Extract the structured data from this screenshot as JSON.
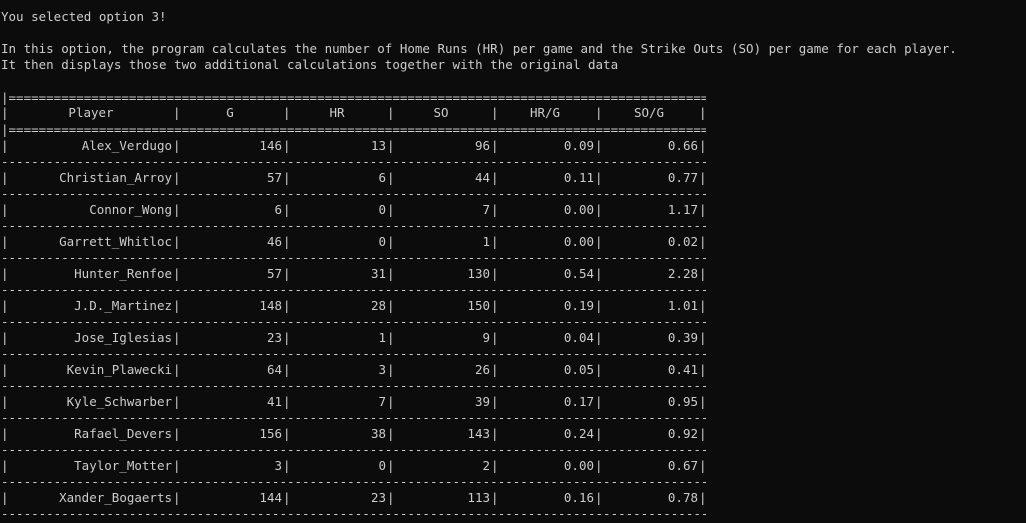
{
  "messages": {
    "selected": "You selected option 3!",
    "desc1": "In this option, the program calculates the number of Home Runs (HR) per game and the Strike Outs (SO) per game for each player.",
    "desc2": "It then displays those two additional calculations together with the original data"
  },
  "table": {
    "top_rule": "|===============================================================================================|",
    "header_rule": "|===============================================================================================|",
    "row_rule": "------------------------------------------------------------------------------------------------",
    "headers": [
      "Player",
      "G",
      "HR",
      "SO",
      "HR/G",
      "SO/G"
    ],
    "rows": [
      [
        "Alex_Verdugo",
        "146",
        "13",
        "96",
        "0.09",
        "0.66"
      ],
      [
        "Christian_Arroy",
        "57",
        "6",
        "44",
        "0.11",
        "0.77"
      ],
      [
        "Connor_Wong",
        "6",
        "0",
        "7",
        "0.00",
        "1.17"
      ],
      [
        "Garrett_Whitloc",
        "46",
        "0",
        "1",
        "0.00",
        "0.02"
      ],
      [
        "Hunter_Renfoe",
        "57",
        "31",
        "130",
        "0.54",
        "2.28"
      ],
      [
        "J.D._Martinez",
        "148",
        "28",
        "150",
        "0.19",
        "1.01"
      ],
      [
        "Jose_Iglesias",
        "23",
        "1",
        "9",
        "0.04",
        "0.39"
      ],
      [
        "Kevin_Plawecki",
        "64",
        "3",
        "26",
        "0.05",
        "0.41"
      ],
      [
        "Kyle_Schwarber",
        "41",
        "7",
        "39",
        "0.17",
        "0.95"
      ],
      [
        "Rafael_Devers",
        "156",
        "38",
        "143",
        "0.24",
        "0.92"
      ],
      [
        "Taylor_Motter",
        "3",
        "0",
        "2",
        "0.00",
        "0.67"
      ],
      [
        "Xander_Bogaerts",
        "144",
        "23",
        "113",
        "0.16",
        "0.78"
      ]
    ]
  }
}
